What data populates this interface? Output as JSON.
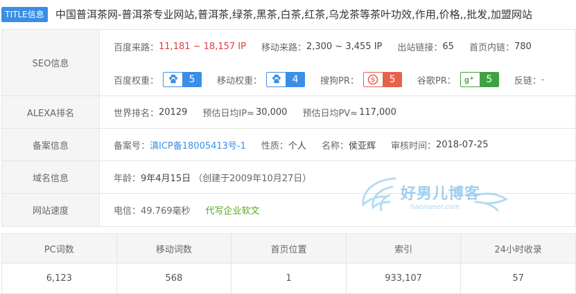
{
  "title": {
    "badge": "TITLE信息",
    "text": "中国普洱茶网-普洱茶专业网站,普洱茶,绿茶,黑茶,白茶,红茶,乌龙茶等茶叶功效,作用,价格,,批发,加盟网站"
  },
  "seo": {
    "label": "SEO信息",
    "baidu_traffic_label": "百度来路：",
    "baidu_traffic_value": "11,181 ~ 18,157 IP",
    "mobile_traffic_label": "移动来路：",
    "mobile_traffic_value": "2,300 ~ 3,455 IP",
    "outbound_label": "出站链接：",
    "outbound_value": "65",
    "homepage_links_label": "首页内链：",
    "homepage_links_value": "780",
    "baidu_weight_label": "百度权重：",
    "baidu_weight_value": "5",
    "mobile_weight_label": "移动权重：",
    "mobile_weight_value": "4",
    "sogou_pr_label": "搜狗PR：",
    "sogou_pr_value": "5",
    "google_pr_label": "谷歌PR：",
    "google_pr_value": "5",
    "backlinks_label": "反链：",
    "backlinks_value": "-"
  },
  "alexa": {
    "label": "ALEXA排名",
    "world_rank_label": "世界排名：",
    "world_rank_value": "20129",
    "daily_ip_label": "预估日均IP≈",
    "daily_ip_value": "30,000",
    "daily_pv_label": "预估日均PV≈",
    "daily_pv_value": "117,000"
  },
  "icp": {
    "label": "备案信息",
    "icp_label": "备案号：",
    "icp_value": "滇ICP备18005413号-1",
    "nature_label": "性质：",
    "nature_value": "个人",
    "name_label": "名称：",
    "name_value": "侯亚辉",
    "audit_label": "审核时间：",
    "audit_value": "2018-07-25"
  },
  "domain": {
    "label": "域名信息",
    "age_label": "年龄：",
    "age_value": "9年4月15日",
    "created": "（创建于2009年10月27日）"
  },
  "speed": {
    "label": "网站速度",
    "telecom": "电信：49.769毫秒",
    "ad_link": "代写企业软文"
  },
  "stats": {
    "headers": [
      "PC词数",
      "移动词数",
      "首页位置",
      "索引",
      "24小时收录"
    ],
    "values": [
      "6,123",
      "568",
      "1",
      "933,107",
      "57"
    ]
  },
  "watermark": {
    "text": "好男儿博客",
    "sub": "haonaner.com"
  },
  "colors": {
    "accent": "#3a8ee6",
    "red": "#e03c3c",
    "sogou": "#e8604c",
    "google": "#3fa142"
  }
}
